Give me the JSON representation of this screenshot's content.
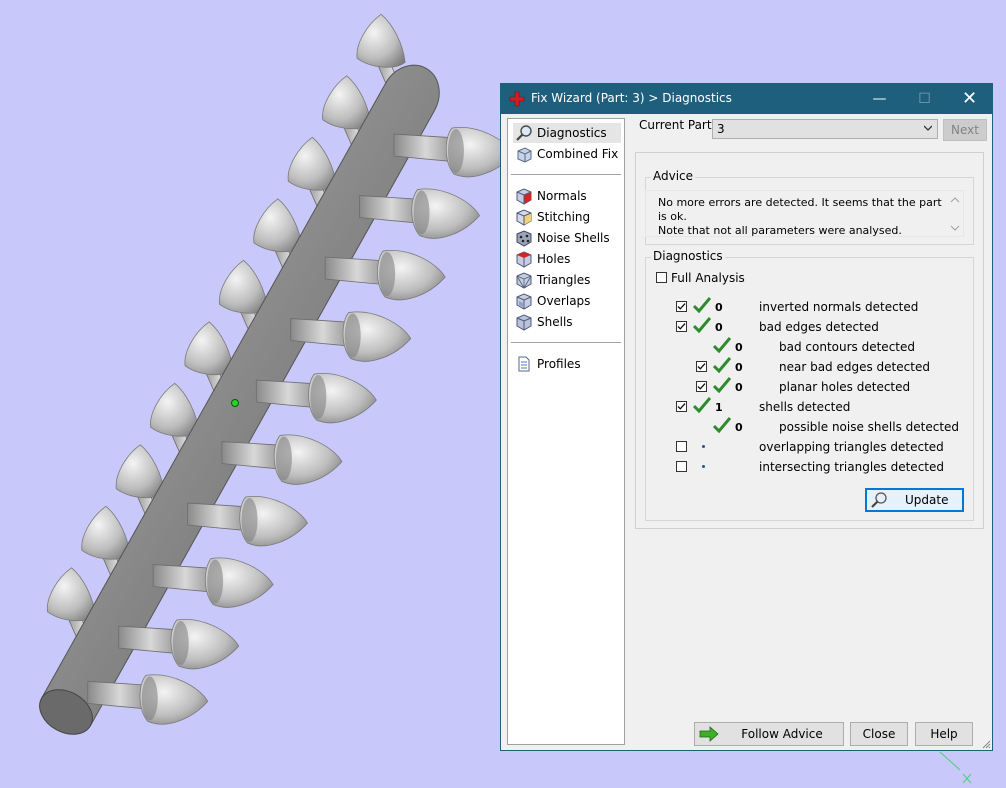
{
  "window": {
    "title": "Fix Wizard (Part: 3) > Diagnostics",
    "minimize_glyph": "—",
    "maximize_glyph": "☐",
    "close_glyph": "✕"
  },
  "nav": {
    "items": [
      {
        "label": "Diagnostics",
        "icon": "magnifier-icon",
        "selected": true
      },
      {
        "label": "Combined Fix",
        "icon": "combined-fix-icon"
      },
      {
        "label": "Normals",
        "icon": "normals-cube-icon"
      },
      {
        "label": "Stitching",
        "icon": "stitching-cube-icon"
      },
      {
        "label": "Noise Shells",
        "icon": "noise-shells-icon"
      },
      {
        "label": "Holes",
        "icon": "holes-cube-icon"
      },
      {
        "label": "Triangles",
        "icon": "triangles-cube-icon"
      },
      {
        "label": "Overlaps",
        "icon": "overlaps-cube-icon"
      },
      {
        "label": "Shells",
        "icon": "shells-cube-icon"
      },
      {
        "label": "Profiles",
        "icon": "profiles-document-icon"
      }
    ]
  },
  "current_part": {
    "label": "Current Part:",
    "value": "3"
  },
  "next_label": "Next",
  "advice": {
    "title": "Advice",
    "text": "No more errors are detected. It seems that the part is ok.\nNote that not all parameters were analysed."
  },
  "diagnostics": {
    "title": "Diagnostics",
    "full_analysis_label": "Full Analysis",
    "full_analysis_checked": false,
    "rows": [
      {
        "checked": true,
        "status": "ok",
        "count": "0",
        "label": "inverted normals detected"
      },
      {
        "checked": true,
        "status": "ok",
        "count": "0",
        "label": "bad edges detected"
      },
      {
        "checked": null,
        "status": "ok",
        "count": "0",
        "label": "bad contours detected"
      },
      {
        "checked": true,
        "status": "ok",
        "count": "0",
        "label": "near bad edges detected"
      },
      {
        "checked": true,
        "status": "ok",
        "count": "0",
        "label": "planar holes detected"
      },
      {
        "checked": true,
        "status": "ok",
        "count": "1",
        "label": "shells detected"
      },
      {
        "checked": null,
        "status": "ok",
        "count": "0",
        "label": "possible noise shells detected"
      },
      {
        "checked": false,
        "status": "not-run",
        "count": "",
        "label": "overlapping triangles detected"
      },
      {
        "checked": false,
        "status": "not-run",
        "count": "",
        "label": "intersecting triangles detected"
      }
    ]
  },
  "update_label": "Update",
  "buttons": {
    "follow_advice": "Follow Advice",
    "close": "Close",
    "help": "Help"
  },
  "colors": {
    "background": "#c8c8fa",
    "titlebar": "#1f5f7e",
    "check_green": "#2e8b2e",
    "focus_blue": "#0078d7"
  }
}
